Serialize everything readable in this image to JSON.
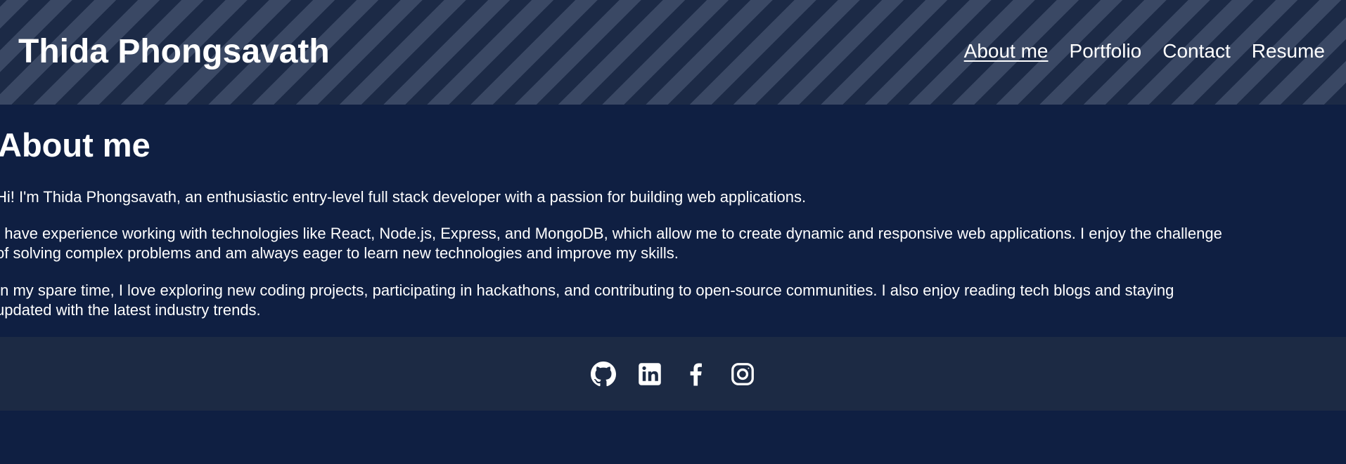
{
  "header": {
    "site_title": "Thida Phongsavath",
    "nav": [
      {
        "label": "About me",
        "active": true
      },
      {
        "label": "Portfolio",
        "active": false
      },
      {
        "label": "Contact",
        "active": false
      },
      {
        "label": "Resume",
        "active": false
      }
    ]
  },
  "main": {
    "section_title": "About me",
    "paragraphs": [
      "Hi! I'm Thida Phongsavath, an enthusiastic entry-level full stack developer with a passion for building web applications.",
      "I have experience working with technologies like React, Node.js, Express, and MongoDB, which allow me to create dynamic and responsive web applications. I enjoy the challenge",
      "of solving complex problems and am always eager to learn new technologies and improve my skills.",
      "In my spare time, I love exploring new coding projects, participating in hackathons, and contributing to open-source communities. I also enjoy reading tech blogs and staying",
      "updated with the latest industry trends."
    ]
  },
  "footer": {
    "social_icons": [
      "github-icon",
      "linkedin-icon",
      "facebook-icon",
      "instagram-icon"
    ]
  },
  "colors": {
    "background": "#0f1f42",
    "header_stripe_dark": "#1c2a46",
    "header_stripe_light": "#3a4864",
    "footer_background": "#1c2a44",
    "text": "#ffffff"
  }
}
